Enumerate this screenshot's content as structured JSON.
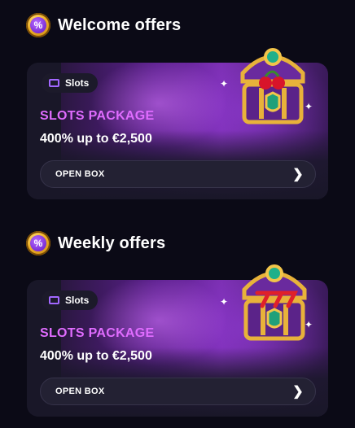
{
  "sections": [
    {
      "title": "Welcome offers",
      "badge_symbol": "%",
      "card": {
        "tag": "Slots",
        "package": "SLOTS PACKAGE",
        "offer": "400% up to €2,500",
        "button": "OPEN BOX",
        "chest_icon": "treasure-chest-cherries-icon"
      }
    },
    {
      "title": "Weekly offers",
      "badge_symbol": "%",
      "card": {
        "tag": "Slots",
        "package": "SLOTS PACKAGE",
        "offer": "400% up to €2,500",
        "button": "OPEN BOX",
        "chest_icon": "treasure-chest-777-icon"
      }
    }
  ],
  "colors": {
    "background": "#0b0a16",
    "package_text": "#e06cff",
    "badge_gold": "#f0b225",
    "card_purple": "#7a2fb0"
  }
}
